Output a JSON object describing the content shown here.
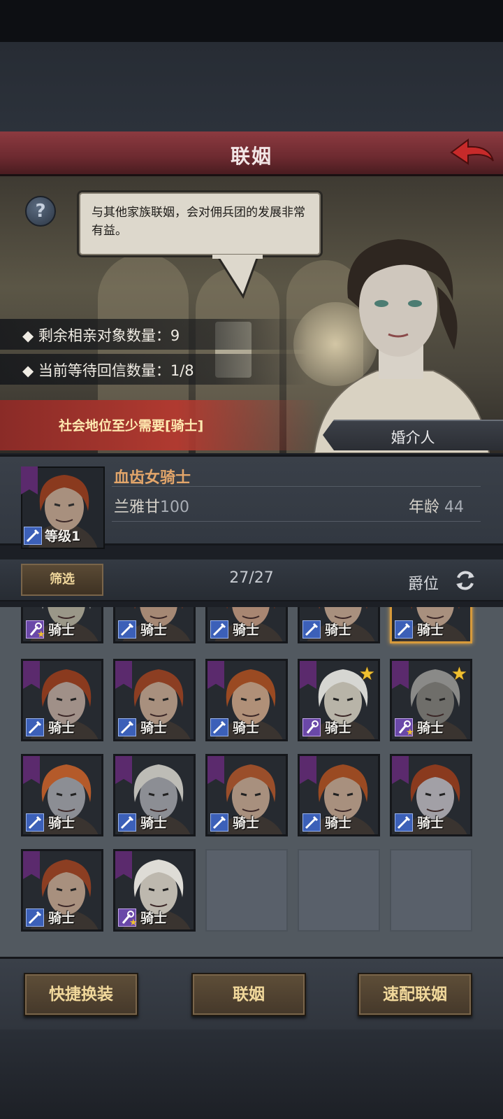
{
  "title": "联姻",
  "speech": "与其他家族联姻，会对佣兵团的发展非常有益。",
  "stats": [
    {
      "label": "◆ 剩余相亲对象数量：",
      "value": "9"
    },
    {
      "label": "◆ 当前等待回信数量：",
      "value": "1/8"
    }
  ],
  "requirement": "社会地位至少需要[骑士]",
  "matchmaker_label": "婚介人",
  "selected": {
    "name": "血齿女骑士",
    "family": "兰雅甘",
    "family_num": "100",
    "age_label": "年龄",
    "age": "44",
    "level_label": "等级",
    "level": "1"
  },
  "filter": {
    "filter_label": "筛选",
    "count": "27/27",
    "sort_label": "爵位"
  },
  "rank_label": "骑士",
  "candidates": [
    {
      "class": "mage",
      "star": false,
      "mini_star": true,
      "hair": "#c9c7c0",
      "skin": "#9a9788"
    },
    {
      "class": "warrior",
      "star": false,
      "mini_star": false,
      "hair": "#8a3a1e",
      "skin": "#a58874"
    },
    {
      "class": "warrior",
      "star": false,
      "mini_star": false,
      "hair": "#7a2e16",
      "skin": "#a88672"
    },
    {
      "class": "warrior",
      "star": false,
      "mini_star": false,
      "hair": "#8c3e22",
      "skin": "#a8907e"
    },
    {
      "class": "warrior",
      "star": false,
      "mini_star": false,
      "hair": "#8a3a1e",
      "skin": "#a8907e",
      "selected": true
    },
    {
      "class": "warrior",
      "star": false,
      "mini_star": false,
      "hair": "#8a3a1e",
      "skin": "#a09088"
    },
    {
      "class": "warrior",
      "star": false,
      "mini_star": false,
      "hair": "#8c3e22",
      "skin": "#a8907e"
    },
    {
      "class": "warrior",
      "star": false,
      "mini_star": false,
      "hair": "#9a4a22",
      "skin": "#b09078"
    },
    {
      "class": "mage",
      "star": true,
      "mini_star": false,
      "hair": "#d6d6d2",
      "skin": "#b8b4a8"
    },
    {
      "class": "mage",
      "star": true,
      "mini_star": true,
      "hair": "#8a8a88",
      "skin": "#6f6e6a"
    },
    {
      "class": "warrior",
      "star": false,
      "mini_star": false,
      "hair": "#b45a2a",
      "skin": "#8c8e94"
    },
    {
      "class": "warrior",
      "star": false,
      "mini_star": false,
      "hair": "#bdbcb6",
      "skin": "#8c8e94"
    },
    {
      "class": "warrior",
      "star": false,
      "mini_star": false,
      "hair": "#9a4e2a",
      "skin": "#a8907e"
    },
    {
      "class": "warrior",
      "star": false,
      "mini_star": false,
      "hair": "#9a4a22",
      "skin": "#a8907e"
    },
    {
      "class": "warrior",
      "star": false,
      "mini_star": false,
      "hair": "#8a3a1e",
      "skin": "#a2a0a6"
    },
    {
      "class": "warrior",
      "star": false,
      "mini_star": false,
      "hair": "#8c3e22",
      "skin": "#a8907e"
    },
    {
      "class": "mage",
      "star": false,
      "mini_star": true,
      "hair": "#dedcd6",
      "skin": "#bdb8ae"
    }
  ],
  "buttons": {
    "quick_equip": "快捷换装",
    "marry": "联姻",
    "quick_match": "速配联姻"
  },
  "colors": {
    "title_bar": "#8c3a40",
    "requirement_band": "#b03a30",
    "name_accent": "#e2a56a",
    "button_text": "#f1d89b",
    "star": "#f0c030"
  }
}
